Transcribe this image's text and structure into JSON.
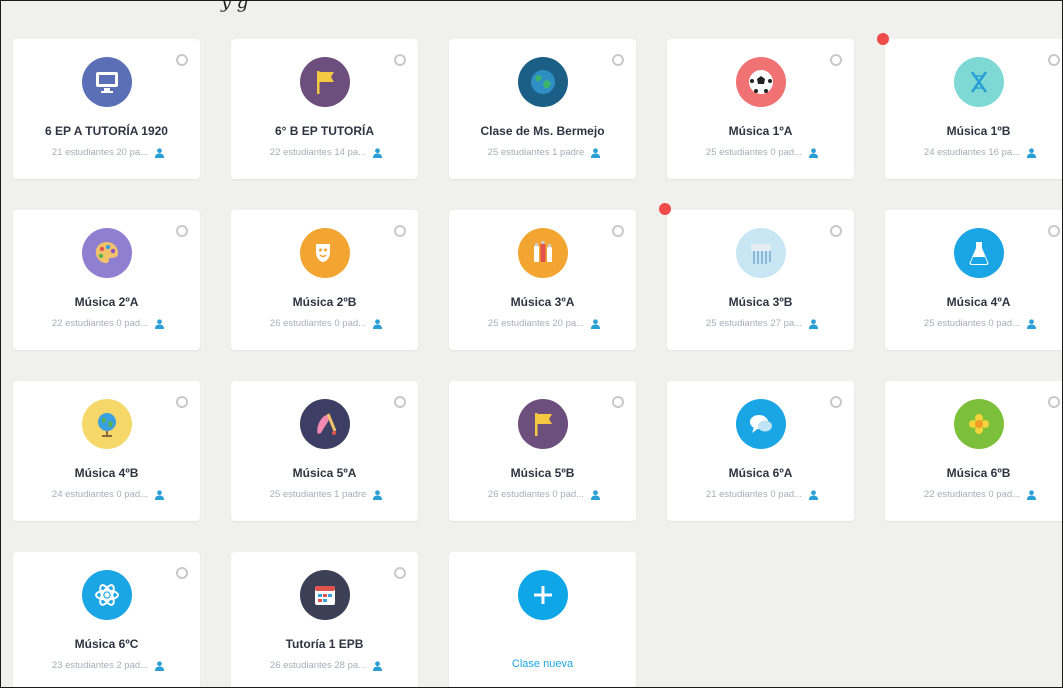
{
  "partial_header": "y g",
  "classes": [
    {
      "name": "6 EP A TUTORÍA 1920",
      "meta": "21 estudiantes 20 pa...",
      "icon": "computer-icon",
      "color": "#5b6fb6"
    },
    {
      "name": "6° B EP TUTORÍA",
      "meta": "22 estudiantes 14 pa...",
      "icon": "flag-icon",
      "color": "#6d4f7d"
    },
    {
      "name": "Clase de Ms. Bermejo",
      "meta": "25 estudiantes 1 padre",
      "icon": "globe-icon",
      "color": "#1b5f86"
    },
    {
      "name": "Música 1ºA",
      "meta": "25 estudiantes 0 pad...",
      "icon": "soccer-ball-icon",
      "color": "#f07272"
    },
    {
      "name": "Música 1ºB",
      "meta": "24 estudiantes 16 pa...",
      "icon": "dna-icon",
      "color": "#7ed9d4"
    },
    {
      "name": "Música 2ºA",
      "meta": "22 estudiantes 0 pad...",
      "icon": "palette-icon",
      "color": "#8e7fd1"
    },
    {
      "name": "Música 2ºB",
      "meta": "26 estudiantes 0 pad...",
      "icon": "theater-masks-icon",
      "color": "#f2a530"
    },
    {
      "name": "Música 3ºA",
      "meta": "25 estudiantes 20 pa...",
      "icon": "paint-tubes-icon",
      "color": "#f2a530"
    },
    {
      "name": "Música 3ºB",
      "meta": "25 estudiantes 27 pa...",
      "icon": "shredder-icon",
      "color": "#c9e6f5"
    },
    {
      "name": "Música 4ºA",
      "meta": "25 estudiantes 0 pad...",
      "icon": "flask-icon",
      "color": "#1aa5e5"
    },
    {
      "name": "Música 4ºB",
      "meta": "24 estudiantes 0 pad...",
      "icon": "globe-stand-icon",
      "color": "#f6d86a"
    },
    {
      "name": "Música 5ºA",
      "meta": "25 estudiantes 1 padre",
      "icon": "paint-brush-icon",
      "color": "#3c3e64"
    },
    {
      "name": "Música 5ºB",
      "meta": "26 estudiantes 0 pad...",
      "icon": "flag-icon",
      "color": "#6d4f7d"
    },
    {
      "name": "Música 6ºA",
      "meta": "21 estudiantes 0 pad...",
      "icon": "chat-bubbles-icon",
      "color": "#1aa5e5"
    },
    {
      "name": "Música 6ºB",
      "meta": "22 estudiantes 0 pad...",
      "icon": "flower-icon",
      "color": "#7cbf3a"
    },
    {
      "name": "Música 6ºC",
      "meta": "23 estudiantes 2 pad...",
      "icon": "atom-icon",
      "color": "#1aa5e5"
    },
    {
      "name": "Tutoría 1 EPB",
      "meta": "26 estudiantes 28 pa...",
      "icon": "calendar-icon",
      "color": "#3c4057"
    }
  ],
  "new_class": {
    "label": "Clase nueva",
    "icon": "plus-icon",
    "color": "#0fa6e8"
  },
  "colors": {
    "background": "#f0f0ee",
    "card": "#ffffff",
    "notification": "#ef4b4b",
    "accent": "#1ea5e5"
  }
}
